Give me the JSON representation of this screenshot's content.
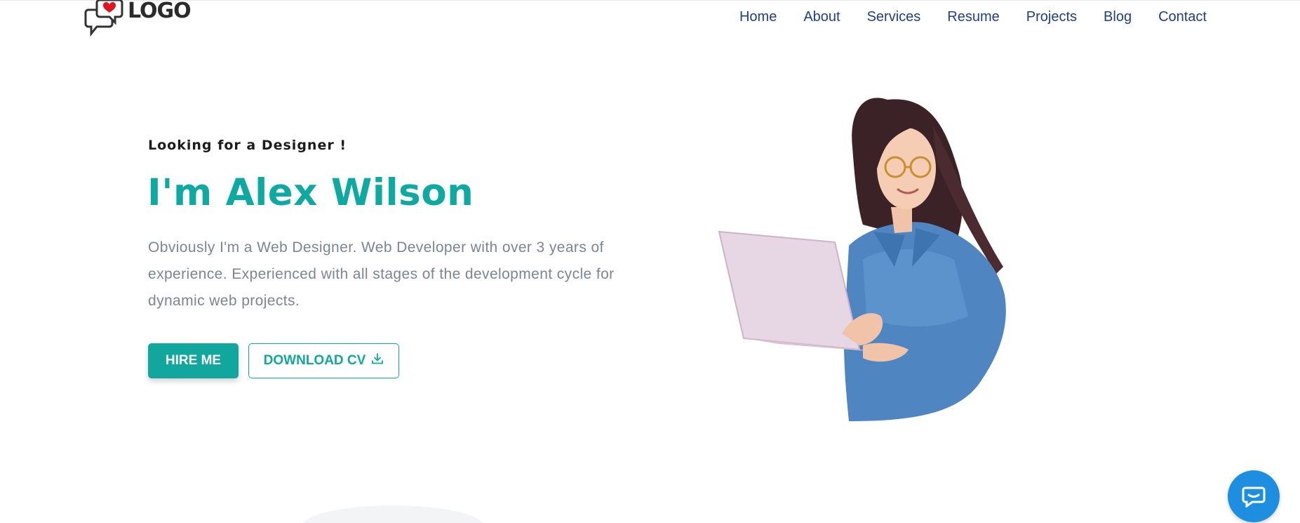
{
  "header": {
    "logo_text": "LOGO",
    "nav": [
      "Home",
      "About",
      "Services",
      "Resume",
      "Projects",
      "Blog",
      "Contact"
    ]
  },
  "hero": {
    "eyebrow": "Looking for a Designer !",
    "title": "I'm Alex Wilson",
    "description": "Obviously I'm a Web Designer. Web Developer with over 3 years of experience. Experienced with all stages of the development cycle for dynamic web projects.",
    "hire_label": "HIRE ME",
    "cv_label": "DOWNLOAD CV"
  },
  "icons": {
    "logo": "chat-bubbles-heart-icon",
    "download": "download-icon",
    "chat": "chat-bubble-icon"
  },
  "colors": {
    "accent": "#0eaaa2",
    "nav": "#1f3f82",
    "body_text": "#7b8594",
    "chat": "#1e8fe0"
  }
}
